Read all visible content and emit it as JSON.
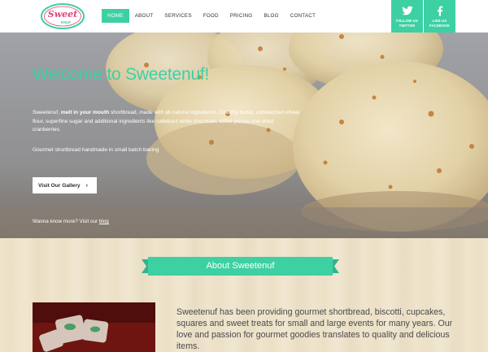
{
  "brand": {
    "logo_text_top": "Sweet",
    "logo_text_bottom": "ENUF"
  },
  "nav": {
    "items": [
      {
        "label": "HOME",
        "active": true
      },
      {
        "label": "ABOUT",
        "active": false
      },
      {
        "label": "SERVICES",
        "active": false
      },
      {
        "label": "FOOD",
        "active": false
      },
      {
        "label": "PRICING",
        "active": false
      },
      {
        "label": "BLOG",
        "active": false
      },
      {
        "label": "CONTACT",
        "active": false
      }
    ]
  },
  "social": {
    "twitter": {
      "line1": "FOLLOW US",
      "line2": "TWITTER",
      "icon": "twitter-bird-icon"
    },
    "facebook": {
      "line1": "LIKE US",
      "line2": "FACEBOOK",
      "icon": "facebook-f-icon"
    }
  },
  "hero": {
    "title": "Welcome to Sweetenuf!",
    "intro_before": "Sweetenuf, ",
    "intro_bold": "melt in your mouth",
    "intro_after": " shortbread, made with all-natural ingredients. Creamy butter, unbleached wheat flour, superfine sugar and additional ingredients like callebaut white chocolate, toffee pieces and dried cranberries.",
    "subtitle": "Gourmet shortbread handmade in small batch baking",
    "button_label": "Visit Our Gallery",
    "button_icon": "chevron-right-icon",
    "more_text": "Wanna know more? Visit our ",
    "more_link": "blog"
  },
  "about": {
    "heading": "About Sweetenuf",
    "body": "Sweetenuf has been providing gourmet shortbread, biscotti, cupcakes, squares and sweet treats for small and large events for many years. Our love and passion for gourmet goodies translates to quality and delicious items."
  },
  "colors": {
    "accent": "#3dd0a3",
    "logo_pink": "#e0457b",
    "header_bg": "#ffffff"
  }
}
